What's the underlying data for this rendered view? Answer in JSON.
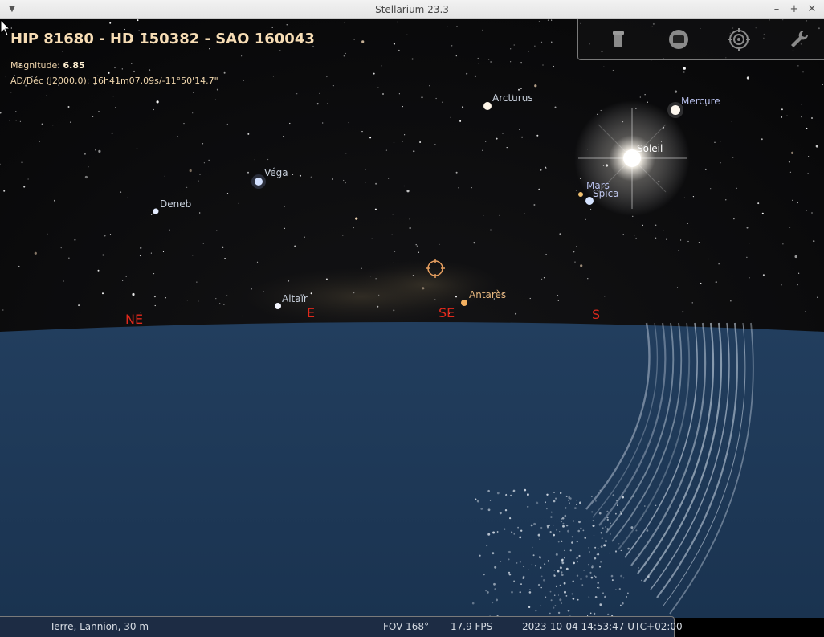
{
  "window": {
    "title": "Stellarium 23.3",
    "menu_icon": "chevron-down-icon",
    "controls": {
      "minimize": "–",
      "maximize": "+",
      "close": "✕"
    }
  },
  "info": {
    "title": "HIP 81680 - HD 150382 - SAO 160043",
    "magnitude_label": "Magnitude:",
    "magnitude_value": "6.85",
    "radec": "AD/Déc (J2000.0): 16h41m07.09s/-11°50'14.7\""
  },
  "toolbar": {
    "buttons": [
      {
        "name": "telescope-icon"
      },
      {
        "name": "screen-icon"
      },
      {
        "name": "target-icon"
      },
      {
        "name": "wrench-icon"
      }
    ]
  },
  "labels": {
    "soleil": "Soleil",
    "mercure": "Mercure",
    "mars": "Mars",
    "spica": "Spica",
    "arcturus": "Arcturus",
    "vega": "Véga",
    "deneb": "Deneb",
    "altair": "Altaïr",
    "antares": "Antarès"
  },
  "cardinals": {
    "ne": "NE",
    "e": "E",
    "se": "SE",
    "s": "S"
  },
  "status": {
    "location": "Terre, Lannion, 30 m",
    "fov": "FOV 168°",
    "fps": "17.9 FPS",
    "datetime": "2023-10-04 14:53:47 UTC+02:00"
  },
  "colors": {
    "cardinal": "#e0291c",
    "planet_label": "#b8c0ec",
    "star_label": "#c8d0dc",
    "antares_label": "#e8b880",
    "ground": "#1f3a5a"
  }
}
